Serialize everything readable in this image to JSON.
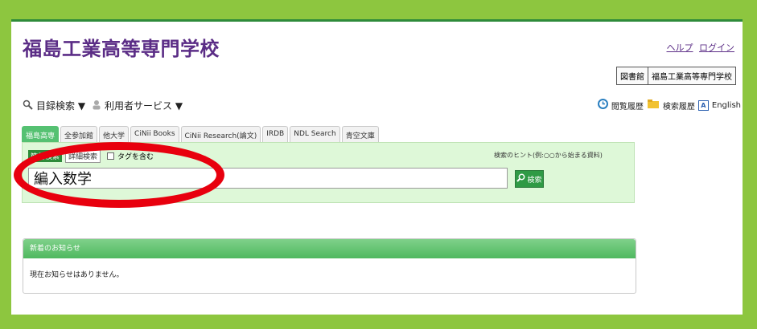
{
  "header": {
    "site_title": "福島工業高等専門学校",
    "help_link": "ヘルプ",
    "login_link": "ログイン",
    "library_label": "図書館",
    "school_label": "福島工業高等専門学校"
  },
  "menu": {
    "catalog_search": "目録検索 ▼",
    "user_services": "利用者サービス ▼"
  },
  "tools": {
    "browse_history": "閲覧履歴",
    "search_history": "検索履歴",
    "english": "English"
  },
  "tabs": [
    {
      "label": "福島高専"
    },
    {
      "label": "全参加館"
    },
    {
      "label": "他大学"
    },
    {
      "label": "CiNii Books"
    },
    {
      "label": "CiNii Research(論文)"
    },
    {
      "label": "IRDB"
    },
    {
      "label": "NDL Search"
    },
    {
      "label": "青空文庫"
    }
  ],
  "search": {
    "simple_label": "簡易検索",
    "detail_label": "詳細検索",
    "include_tags": "タグを含む",
    "hint": "検索のヒント(例:○○から始まる資料)",
    "query_value": "編入数学",
    "button_label": "検索"
  },
  "news": {
    "header": "新着のお知らせ",
    "body": "現在お知らせはありません。"
  },
  "colors": {
    "background": "#8dc63f",
    "title_purple": "#5b2d86",
    "accent_green": "#2f9a45",
    "highlight_red": "#e8000e"
  }
}
